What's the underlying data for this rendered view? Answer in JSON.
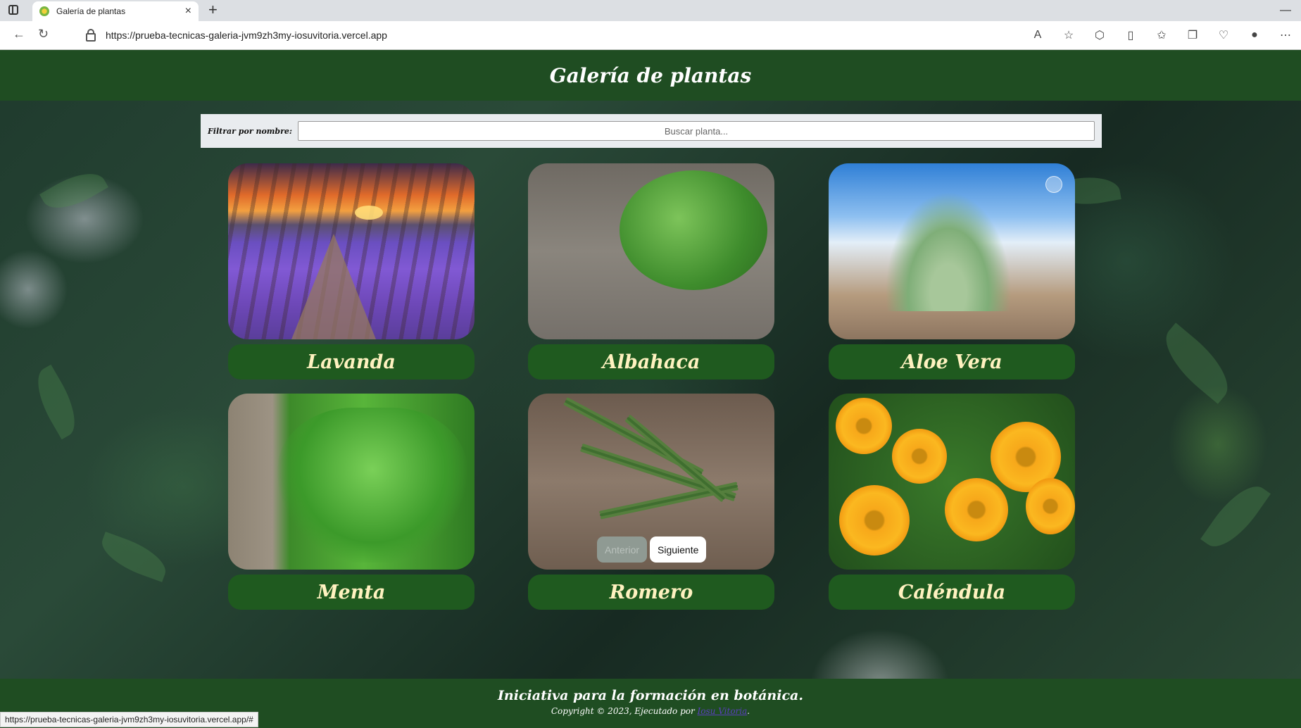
{
  "browser": {
    "tab_title": "Galería de plantas",
    "url": "https://prueba-tecnicas-galeria-jvm9zh3my-iosuvitoria.vercel.app",
    "status_url": "https://prueba-tecnicas-galeria-jvm9zh3my-iosuvitoria.vercel.app/#"
  },
  "header": {
    "title": "Galería de plantas"
  },
  "filter": {
    "label": "Filtrar por nombre:",
    "placeholder": "Buscar planta..."
  },
  "plants": [
    {
      "name": "Lavanda"
    },
    {
      "name": "Albahaca"
    },
    {
      "name": "Aloe Vera"
    },
    {
      "name": "Menta"
    },
    {
      "name": "Romero"
    },
    {
      "name": "Caléndula"
    }
  ],
  "pagination": {
    "prev_label": "Anterior",
    "next_label": "Siguiente"
  },
  "footer": {
    "tagline": "Iniciativa para la formación en botánica.",
    "copyright_prefix": "Copyright © 2023, Ejecutado por",
    "author_link": "Iosu Vitoria",
    "copyright_suffix": "."
  },
  "colors": {
    "header_bg": "#1f4d22",
    "card_label_bg": "#1f5a1f",
    "card_label_text": "#fff2c0"
  }
}
